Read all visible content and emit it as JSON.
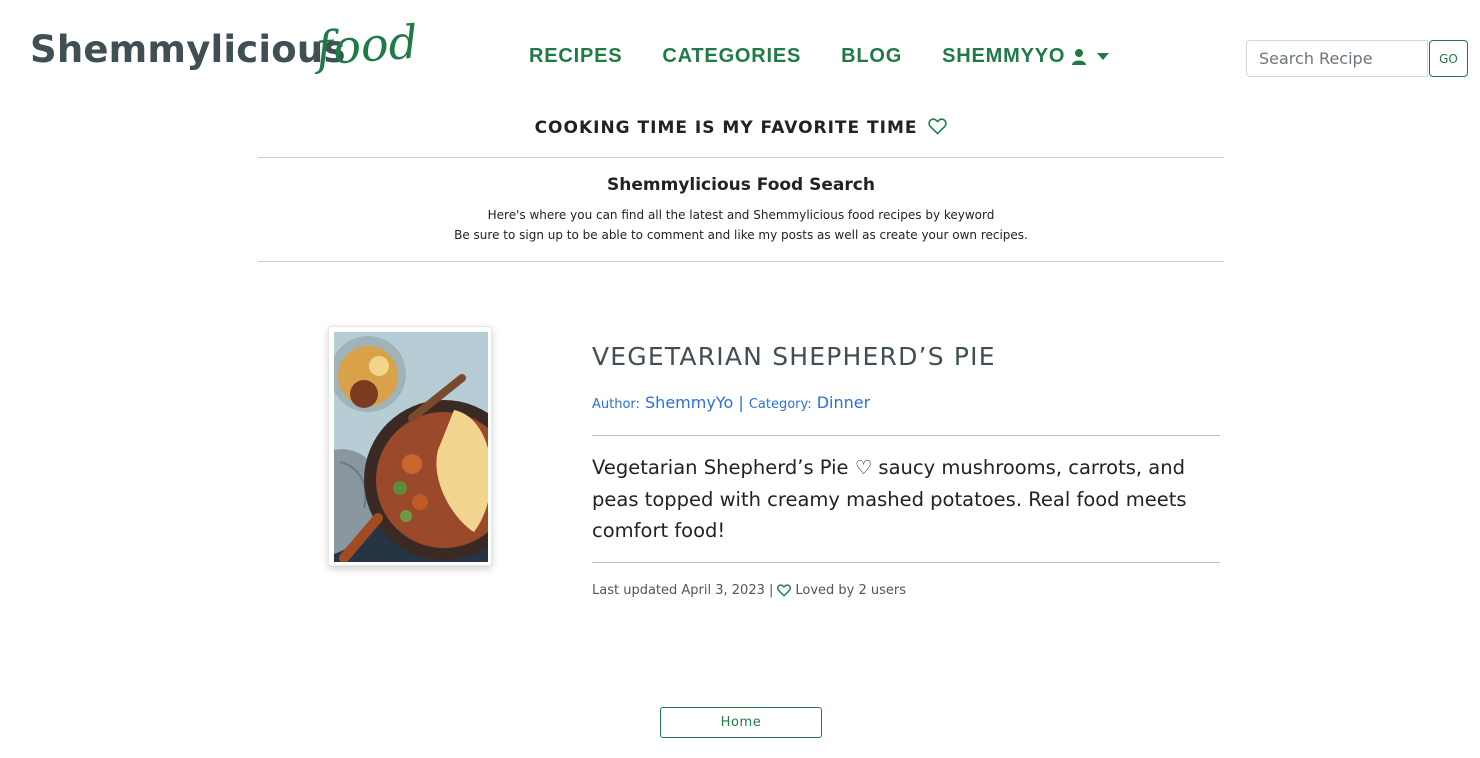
{
  "brand": {
    "main": "Shemmylicious",
    "script": "food"
  },
  "nav": {
    "recipes": "RECIPES",
    "categories": "CATEGORIES",
    "blog": "BLOG",
    "user": "SHEMMYYO"
  },
  "search": {
    "placeholder": "Search Recipe",
    "button": "GO"
  },
  "tagline": "COOKING TIME IS MY FAVORITE TIME",
  "intro": {
    "title": "Shemmylicious Food Search",
    "line1": "Here's where you can find all the latest and Shemmylicious food recipes by keyword",
    "line2": "Be sure to sign up to be able to comment and like my posts as well as create your own recipes."
  },
  "recipe": {
    "title": "VEGETARIAN SHEPHERD’S PIE",
    "author_label": "Author:",
    "author": "ShemmyYo",
    "separator": "|",
    "category_label": "Category:",
    "category": "Dinner",
    "description": "Vegetarian Shepherd’s Pie ♡ saucy mushrooms, carrots, and peas topped with creamy mashed potatoes. Real food meets comfort food!",
    "updated": "Last updated April 3, 2023 |",
    "loved": "Loved by 2 users"
  },
  "home_button": "Home",
  "colors": {
    "accent": "#1f7a46",
    "brand_text": "#3f4f54",
    "link": "#2a6fdb"
  }
}
